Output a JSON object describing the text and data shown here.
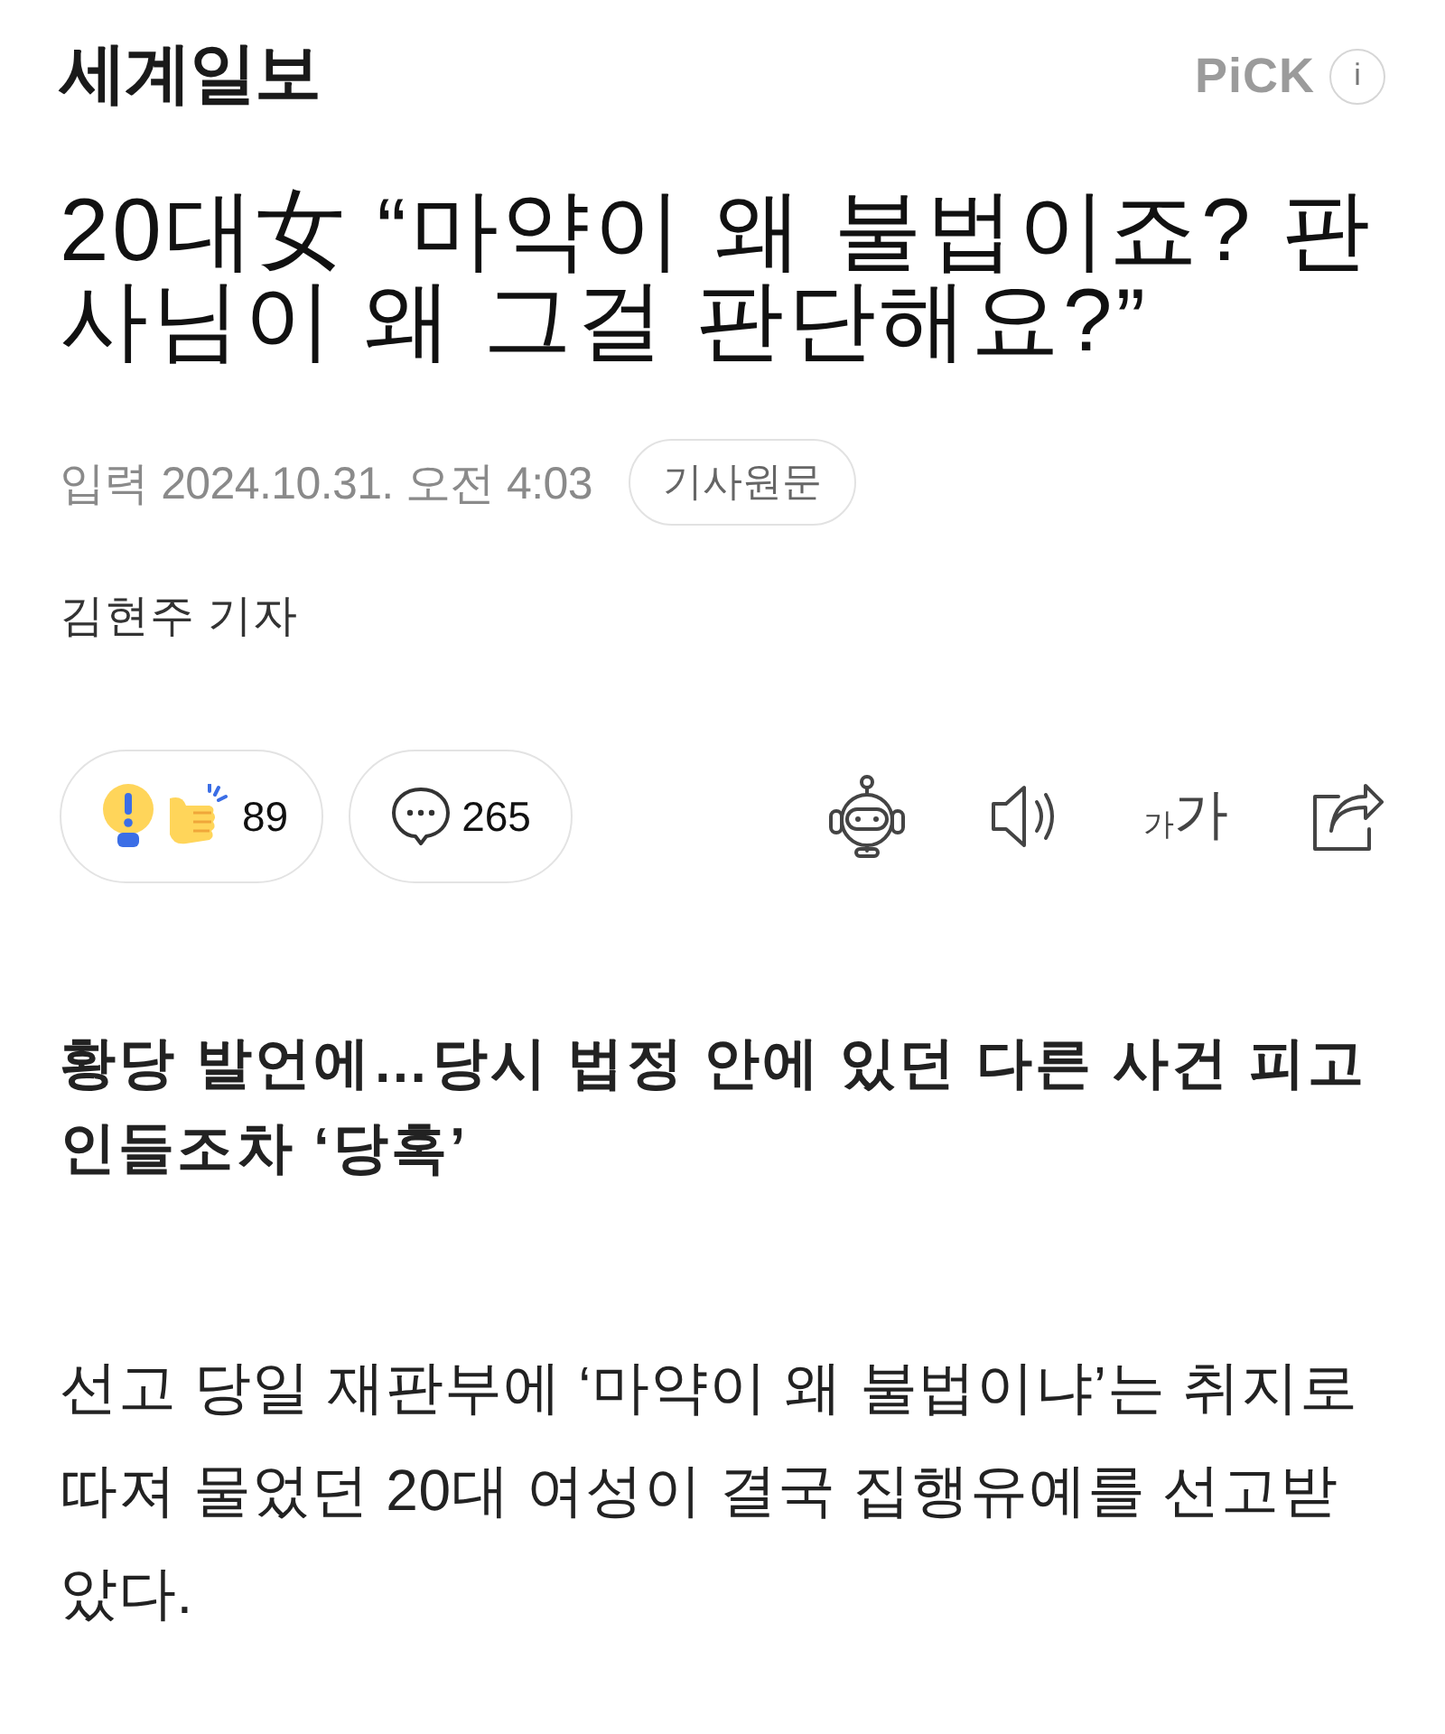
{
  "header": {
    "logo": "세계일보",
    "pick": "PiCK",
    "info": "i"
  },
  "article": {
    "headline": "20대女 “마약이 왜 불법이죠? 판사님이 왜 그걸 판단해요?”",
    "published": {
      "label": "입력",
      "datetime": "2024.10.31. 오전 4:03"
    },
    "original_link": "기사원문",
    "byline": "김현주 기자"
  },
  "reactions": [
    {
      "kind": "reaction",
      "count": "89"
    },
    {
      "kind": "comment",
      "count": "265"
    }
  ],
  "tools": [
    {
      "kind": "summary"
    },
    {
      "kind": "listen"
    },
    {
      "kind": "font_size",
      "small": "가",
      "large": "가"
    },
    {
      "kind": "share"
    }
  ],
  "subtitle": "황당 발언에…당시 법정 안에 있던 다른 사건 피고인들조차 ‘당혹’",
  "body": "선고 당일 재판부에 ‘마약이 왜 불법이냐’는 취지로 따져 물었던 20대 여성이 결국 집행유예를 선고받았다."
}
